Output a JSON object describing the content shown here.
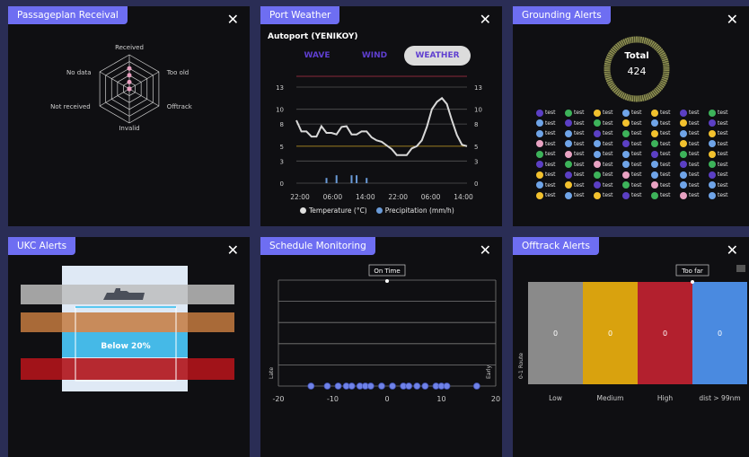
{
  "colors": {
    "background": "#2a2d55",
    "panel": "#0f0f12",
    "title_bar": "#6e6ef2",
    "text": "#ffffff"
  },
  "icons": {
    "close": "close-icon"
  },
  "close_glyph": "✕",
  "panels": {
    "passage": {
      "title": "Passageplan Receival",
      "radar_labels": [
        "Received",
        "Too old",
        "Offtrack",
        "Invalid",
        "Not received",
        "No data"
      ]
    },
    "weather": {
      "title": "Port Weather",
      "location": "Autoport (YENIKOY)",
      "tabs": [
        {
          "label": "WAVE",
          "active": false
        },
        {
          "label": "WIND",
          "active": false
        },
        {
          "label": "WEATHER",
          "active": true
        }
      ],
      "legend": [
        "Temperature (°C)",
        "Precipitation (mm/h)"
      ]
    },
    "grounding": {
      "title": "Grounding Alerts",
      "total_label": "Total",
      "total_value": "424",
      "legend_item_label": "test",
      "legend_rows": 9,
      "legend_cols": 7
    },
    "ukc": {
      "title": "UKC Alerts",
      "band_label": "Below 20%"
    },
    "schedule": {
      "title": "Schedule Monitoring",
      "marker_label": "On Time",
      "left_axis_label": "Late",
      "right_axis_label": "Early"
    },
    "offtrack": {
      "title": "Offtrack Alerts",
      "marker_label": "Too far",
      "ylabel": "0-1 Route"
    }
  },
  "chart_data": [
    {
      "chart_id": "passage-radar",
      "type": "radar",
      "categories": [
        "Received",
        "Too old",
        "Offtrack",
        "Invalid",
        "Not received",
        "No data"
      ],
      "values": [
        0,
        0,
        0,
        0,
        0,
        0
      ]
    },
    {
      "chart_id": "weather",
      "type": "line",
      "x_ticks": [
        "22:00",
        "06:00",
        "14:00",
        "22:00",
        "06:00",
        "14:00"
      ],
      "y_ticks": [
        0,
        3,
        5,
        8,
        10,
        13
      ],
      "ylim": [
        0,
        13
      ],
      "series": [
        {
          "name": "Temperature (°C)",
          "color": "#d8d8d8",
          "values": [
            8.5,
            7,
            7,
            6.3,
            6.3,
            7.7,
            6.8,
            6.8,
            6.6,
            7.6,
            7.7,
            6.6,
            6.6,
            7,
            7,
            6.2,
            5.8,
            5.6,
            5.1,
            4.6,
            3.8,
            3.8,
            3.8,
            4.7,
            5,
            5.8,
            7.6,
            10,
            11,
            11.5,
            10.7,
            8.5,
            6.5,
            5.2,
            5
          ]
        },
        {
          "name": "Precipitation (mm/h)",
          "color": "#6a9bd8",
          "values": [
            0,
            0,
            0,
            0,
            0,
            0,
            0.3,
            0,
            0.8,
            0,
            0,
            0.8,
            0.8,
            0,
            0.3,
            0,
            0,
            0,
            0,
            0,
            0,
            0,
            0,
            0,
            0,
            0,
            0,
            0,
            0,
            0,
            0,
            0,
            0,
            0,
            0
          ]
        }
      ],
      "threshold": 5
    },
    {
      "chart_id": "grounding-donut",
      "type": "pie",
      "total": 424
    },
    {
      "chart_id": "schedule",
      "type": "scatter",
      "xlim": [
        -20,
        20
      ],
      "x_ticks": [
        -20,
        -10,
        0,
        10,
        20
      ],
      "marker": 0,
      "points_x": [
        -14,
        -11,
        -9,
        -7.5,
        -6.5,
        -5,
        -4,
        -3,
        -1,
        1,
        3,
        4,
        5.5,
        7,
        9,
        10,
        11,
        16.5
      ]
    },
    {
      "chart_id": "offtrack",
      "type": "bar",
      "categories": [
        "Low",
        "Medium",
        "High",
        "dist > 99nm"
      ],
      "values": [
        1,
        1,
        1,
        1
      ],
      "data_labels": [
        "0",
        "0",
        "0",
        "0"
      ],
      "colors": [
        "#8a8a8a",
        "#d9a20e",
        "#b3202e",
        "#4a8ae0"
      ]
    }
  ]
}
